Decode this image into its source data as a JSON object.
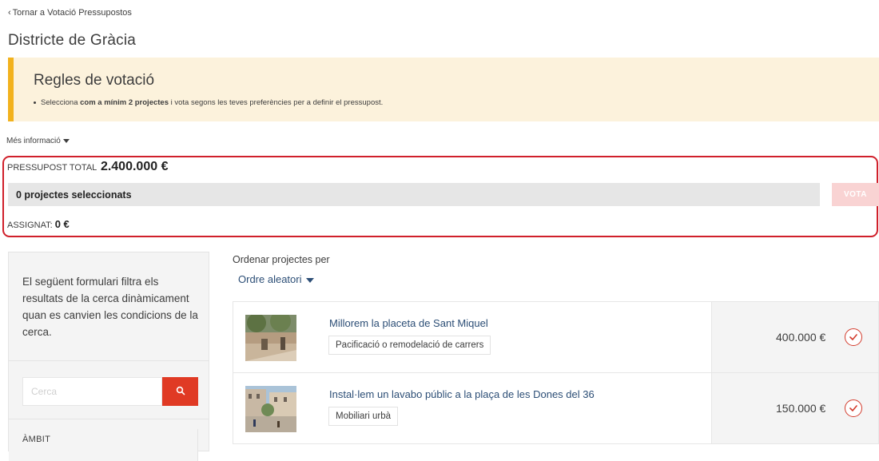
{
  "nav": {
    "back_chevron": "‹",
    "back_label": "Tornar a Votació Pressupostos"
  },
  "page": {
    "title": "Districte de Gràcia"
  },
  "rules": {
    "title": "Regles de votació",
    "text_before": "Selecciona ",
    "text_bold": "com a mínim 2 projectes",
    "text_after": " i vota segons les teves preferències per a definir el pressupost."
  },
  "more_info": {
    "label": "Més informació"
  },
  "budget": {
    "total_label": "PRESSUPOST TOTAL",
    "total_amount": "2.400.000 €",
    "selected_text": "0 projectes seleccionats",
    "selected_fraction": 0,
    "vote_label": "VOTA",
    "assigned_label": "ASSIGNAT:",
    "assigned_amount": "0 €"
  },
  "filters": {
    "description": "El següent formulari filtra els resultats de la cerca dinàmicament quan es canvien les condicions de la cerca.",
    "search_placeholder": "Cerca",
    "scope_label": "ÀMBIT"
  },
  "sort": {
    "label": "Ordenar projectes per",
    "selected": "Ordre aleatori"
  },
  "projects": [
    {
      "title": "Millorem la placeta de Sant Miquel",
      "tag": "Pacificació o remodelació de carrers",
      "price": "400.000 €"
    },
    {
      "title": "Instal·lem un lavabo públic a la plaça de les Dones del 36",
      "tag": "Mobiliari urbà",
      "price": "150.000 €"
    }
  ],
  "colors": {
    "accent": "#e03a24",
    "warning_bar": "#f2b21d",
    "warning_bg": "#fcf2dc",
    "link": "#2c4e76",
    "highlight_frame": "#d0202b"
  }
}
